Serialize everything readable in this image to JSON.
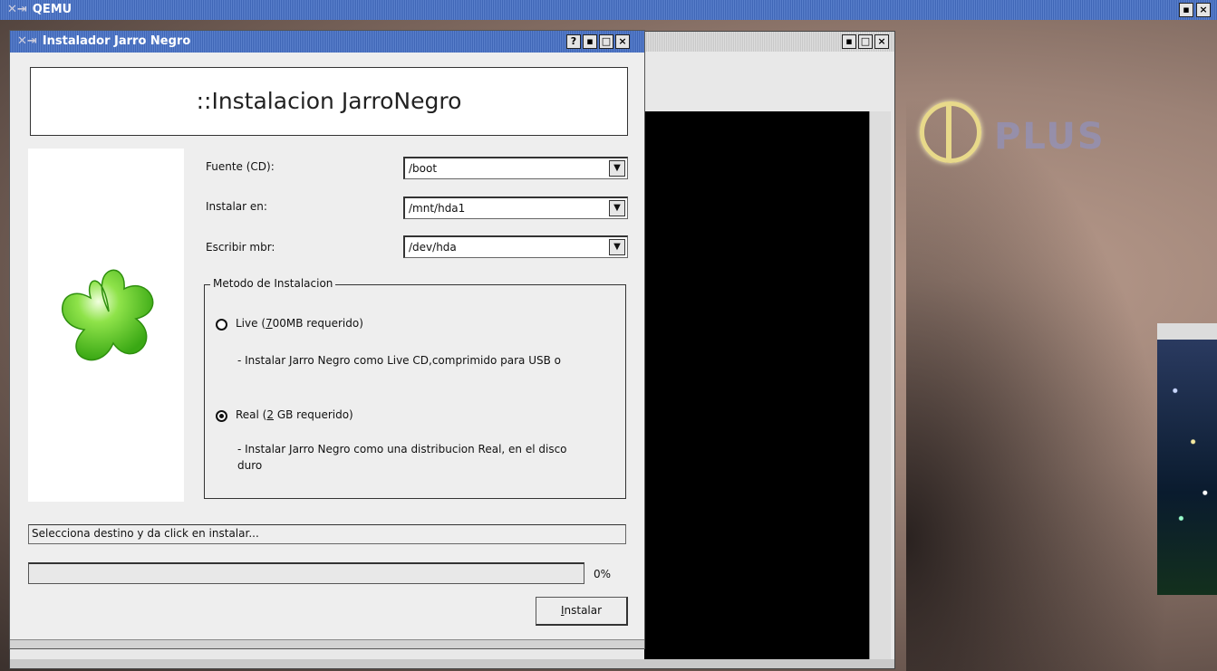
{
  "qemu": {
    "title": "QEMU"
  },
  "desktop": {
    "overlay_text": "PLUS"
  },
  "dialog": {
    "title": "Instalador Jarro Negro",
    "title_buttons": [
      "?",
      "▪",
      "□",
      "×"
    ],
    "header": "::Instalacion JarroNegro",
    "fields": [
      {
        "label": "Fuente (CD):",
        "value": "/boot"
      },
      {
        "label": "Instalar en:",
        "value": "/mnt/hda1"
      },
      {
        "label": "Escribir mbr:",
        "value": "/dev/hda"
      }
    ],
    "method_group": {
      "legend": "Metodo de Instalacion",
      "options": [
        {
          "label_pre": "Live (",
          "label_key": "7",
          "label_post": "00MB requerido)",
          "selected": false,
          "description": "- Instalar Jarro Negro como Live CD,comprimido para USB o"
        },
        {
          "label_pre": "Real (",
          "label_key": "2",
          "label_post": " GB requerido)",
          "selected": true,
          "description_line1": "- Instalar Jarro Negro como una distribucion Real, en el disco",
          "description_line2": "duro"
        }
      ]
    },
    "status": "Selecciona destino y da click en instalar...",
    "progress_percent": "0%",
    "progress_value": 0,
    "install_button": {
      "key": "I",
      "rest": "nstalar"
    }
  },
  "icons": [
    "clover-logo-icon",
    "window-menu-icon",
    "dropdown-arrow-icon"
  ],
  "colors": {
    "titlebar": "#4a70c0",
    "clover": "#5cd02a"
  }
}
